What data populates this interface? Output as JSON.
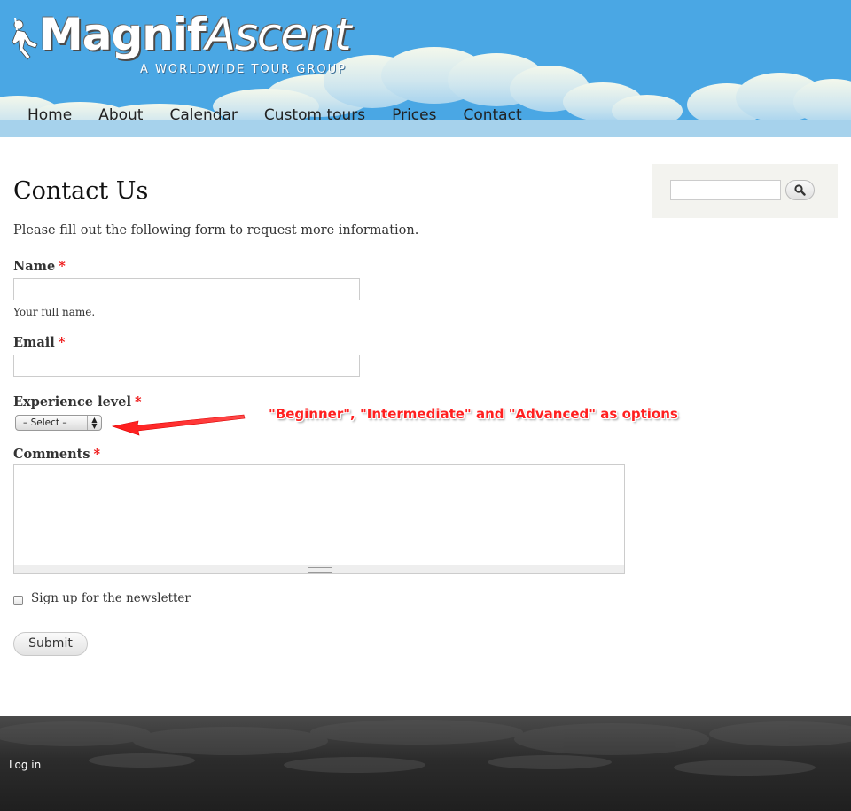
{
  "header": {
    "logo_name_part1": "Magnif",
    "logo_name_part2": "Ascent",
    "logo_tagline": "A WORLDWIDE TOUR GROUP"
  },
  "nav": {
    "items": [
      {
        "label": "Home"
      },
      {
        "label": "About"
      },
      {
        "label": "Calendar"
      },
      {
        "label": "Custom tours"
      },
      {
        "label": "Prices"
      },
      {
        "label": "Contact"
      }
    ]
  },
  "main": {
    "title": "Contact Us",
    "intro": "Please fill out the following form to request more information.",
    "form": {
      "required_marker": "*",
      "name_label": "Name",
      "name_value": "",
      "name_description": "Your full name.",
      "email_label": "Email",
      "email_value": "",
      "experience_label": "Experience level",
      "experience_selected": "– Select –",
      "comments_label": "Comments",
      "comments_value": "",
      "newsletter_label": "Sign up for the newsletter",
      "newsletter_checked": false,
      "submit_label": "Submit"
    },
    "annotation": "\"Beginner\", \"Intermediate\" and \"Advanced\" as options"
  },
  "sidebar": {
    "search_value": "",
    "search_icon": "magnifier-icon"
  },
  "footer": {
    "login_label": "Log in"
  },
  "colors": {
    "header_sky": "#4aa7e4",
    "required": "#e11111",
    "annotation": "#ff2020",
    "footer_dark": "#2c2c2c"
  }
}
